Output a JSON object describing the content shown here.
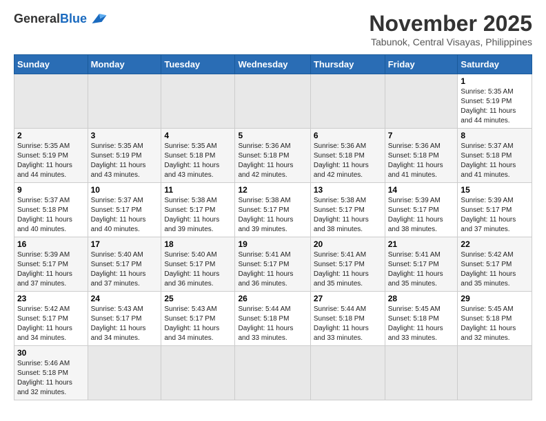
{
  "header": {
    "logo": {
      "general": "General",
      "blue": "Blue"
    },
    "title": "November 2025",
    "subtitle": "Tabunok, Central Visayas, Philippines"
  },
  "days_of_week": [
    "Sunday",
    "Monday",
    "Tuesday",
    "Wednesday",
    "Thursday",
    "Friday",
    "Saturday"
  ],
  "weeks": [
    [
      {
        "day": "",
        "info": ""
      },
      {
        "day": "",
        "info": ""
      },
      {
        "day": "",
        "info": ""
      },
      {
        "day": "",
        "info": ""
      },
      {
        "day": "",
        "info": ""
      },
      {
        "day": "",
        "info": ""
      },
      {
        "day": "1",
        "info": "Sunrise: 5:35 AM\nSunset: 5:19 PM\nDaylight: 11 hours\nand 44 minutes."
      }
    ],
    [
      {
        "day": "2",
        "info": "Sunrise: 5:35 AM\nSunset: 5:19 PM\nDaylight: 11 hours\nand 44 minutes."
      },
      {
        "day": "3",
        "info": "Sunrise: 5:35 AM\nSunset: 5:19 PM\nDaylight: 11 hours\nand 43 minutes."
      },
      {
        "day": "4",
        "info": "Sunrise: 5:35 AM\nSunset: 5:18 PM\nDaylight: 11 hours\nand 43 minutes."
      },
      {
        "day": "5",
        "info": "Sunrise: 5:36 AM\nSunset: 5:18 PM\nDaylight: 11 hours\nand 42 minutes."
      },
      {
        "day": "6",
        "info": "Sunrise: 5:36 AM\nSunset: 5:18 PM\nDaylight: 11 hours\nand 42 minutes."
      },
      {
        "day": "7",
        "info": "Sunrise: 5:36 AM\nSunset: 5:18 PM\nDaylight: 11 hours\nand 41 minutes."
      },
      {
        "day": "8",
        "info": "Sunrise: 5:37 AM\nSunset: 5:18 PM\nDaylight: 11 hours\nand 41 minutes."
      }
    ],
    [
      {
        "day": "9",
        "info": "Sunrise: 5:37 AM\nSunset: 5:18 PM\nDaylight: 11 hours\nand 40 minutes."
      },
      {
        "day": "10",
        "info": "Sunrise: 5:37 AM\nSunset: 5:17 PM\nDaylight: 11 hours\nand 40 minutes."
      },
      {
        "day": "11",
        "info": "Sunrise: 5:38 AM\nSunset: 5:17 PM\nDaylight: 11 hours\nand 39 minutes."
      },
      {
        "day": "12",
        "info": "Sunrise: 5:38 AM\nSunset: 5:17 PM\nDaylight: 11 hours\nand 39 minutes."
      },
      {
        "day": "13",
        "info": "Sunrise: 5:38 AM\nSunset: 5:17 PM\nDaylight: 11 hours\nand 38 minutes."
      },
      {
        "day": "14",
        "info": "Sunrise: 5:39 AM\nSunset: 5:17 PM\nDaylight: 11 hours\nand 38 minutes."
      },
      {
        "day": "15",
        "info": "Sunrise: 5:39 AM\nSunset: 5:17 PM\nDaylight: 11 hours\nand 37 minutes."
      }
    ],
    [
      {
        "day": "16",
        "info": "Sunrise: 5:39 AM\nSunset: 5:17 PM\nDaylight: 11 hours\nand 37 minutes."
      },
      {
        "day": "17",
        "info": "Sunrise: 5:40 AM\nSunset: 5:17 PM\nDaylight: 11 hours\nand 37 minutes."
      },
      {
        "day": "18",
        "info": "Sunrise: 5:40 AM\nSunset: 5:17 PM\nDaylight: 11 hours\nand 36 minutes."
      },
      {
        "day": "19",
        "info": "Sunrise: 5:41 AM\nSunset: 5:17 PM\nDaylight: 11 hours\nand 36 minutes."
      },
      {
        "day": "20",
        "info": "Sunrise: 5:41 AM\nSunset: 5:17 PM\nDaylight: 11 hours\nand 35 minutes."
      },
      {
        "day": "21",
        "info": "Sunrise: 5:41 AM\nSunset: 5:17 PM\nDaylight: 11 hours\nand 35 minutes."
      },
      {
        "day": "22",
        "info": "Sunrise: 5:42 AM\nSunset: 5:17 PM\nDaylight: 11 hours\nand 35 minutes."
      }
    ],
    [
      {
        "day": "23",
        "info": "Sunrise: 5:42 AM\nSunset: 5:17 PM\nDaylight: 11 hours\nand 34 minutes."
      },
      {
        "day": "24",
        "info": "Sunrise: 5:43 AM\nSunset: 5:17 PM\nDaylight: 11 hours\nand 34 minutes."
      },
      {
        "day": "25",
        "info": "Sunrise: 5:43 AM\nSunset: 5:17 PM\nDaylight: 11 hours\nand 34 minutes."
      },
      {
        "day": "26",
        "info": "Sunrise: 5:44 AM\nSunset: 5:18 PM\nDaylight: 11 hours\nand 33 minutes."
      },
      {
        "day": "27",
        "info": "Sunrise: 5:44 AM\nSunset: 5:18 PM\nDaylight: 11 hours\nand 33 minutes."
      },
      {
        "day": "28",
        "info": "Sunrise: 5:45 AM\nSunset: 5:18 PM\nDaylight: 11 hours\nand 33 minutes."
      },
      {
        "day": "29",
        "info": "Sunrise: 5:45 AM\nSunset: 5:18 PM\nDaylight: 11 hours\nand 32 minutes."
      }
    ],
    [
      {
        "day": "30",
        "info": "Sunrise: 5:46 AM\nSunset: 5:18 PM\nDaylight: 11 hours\nand 32 minutes."
      },
      {
        "day": "",
        "info": ""
      },
      {
        "day": "",
        "info": ""
      },
      {
        "day": "",
        "info": ""
      },
      {
        "day": "",
        "info": ""
      },
      {
        "day": "",
        "info": ""
      },
      {
        "day": "",
        "info": ""
      }
    ]
  ]
}
